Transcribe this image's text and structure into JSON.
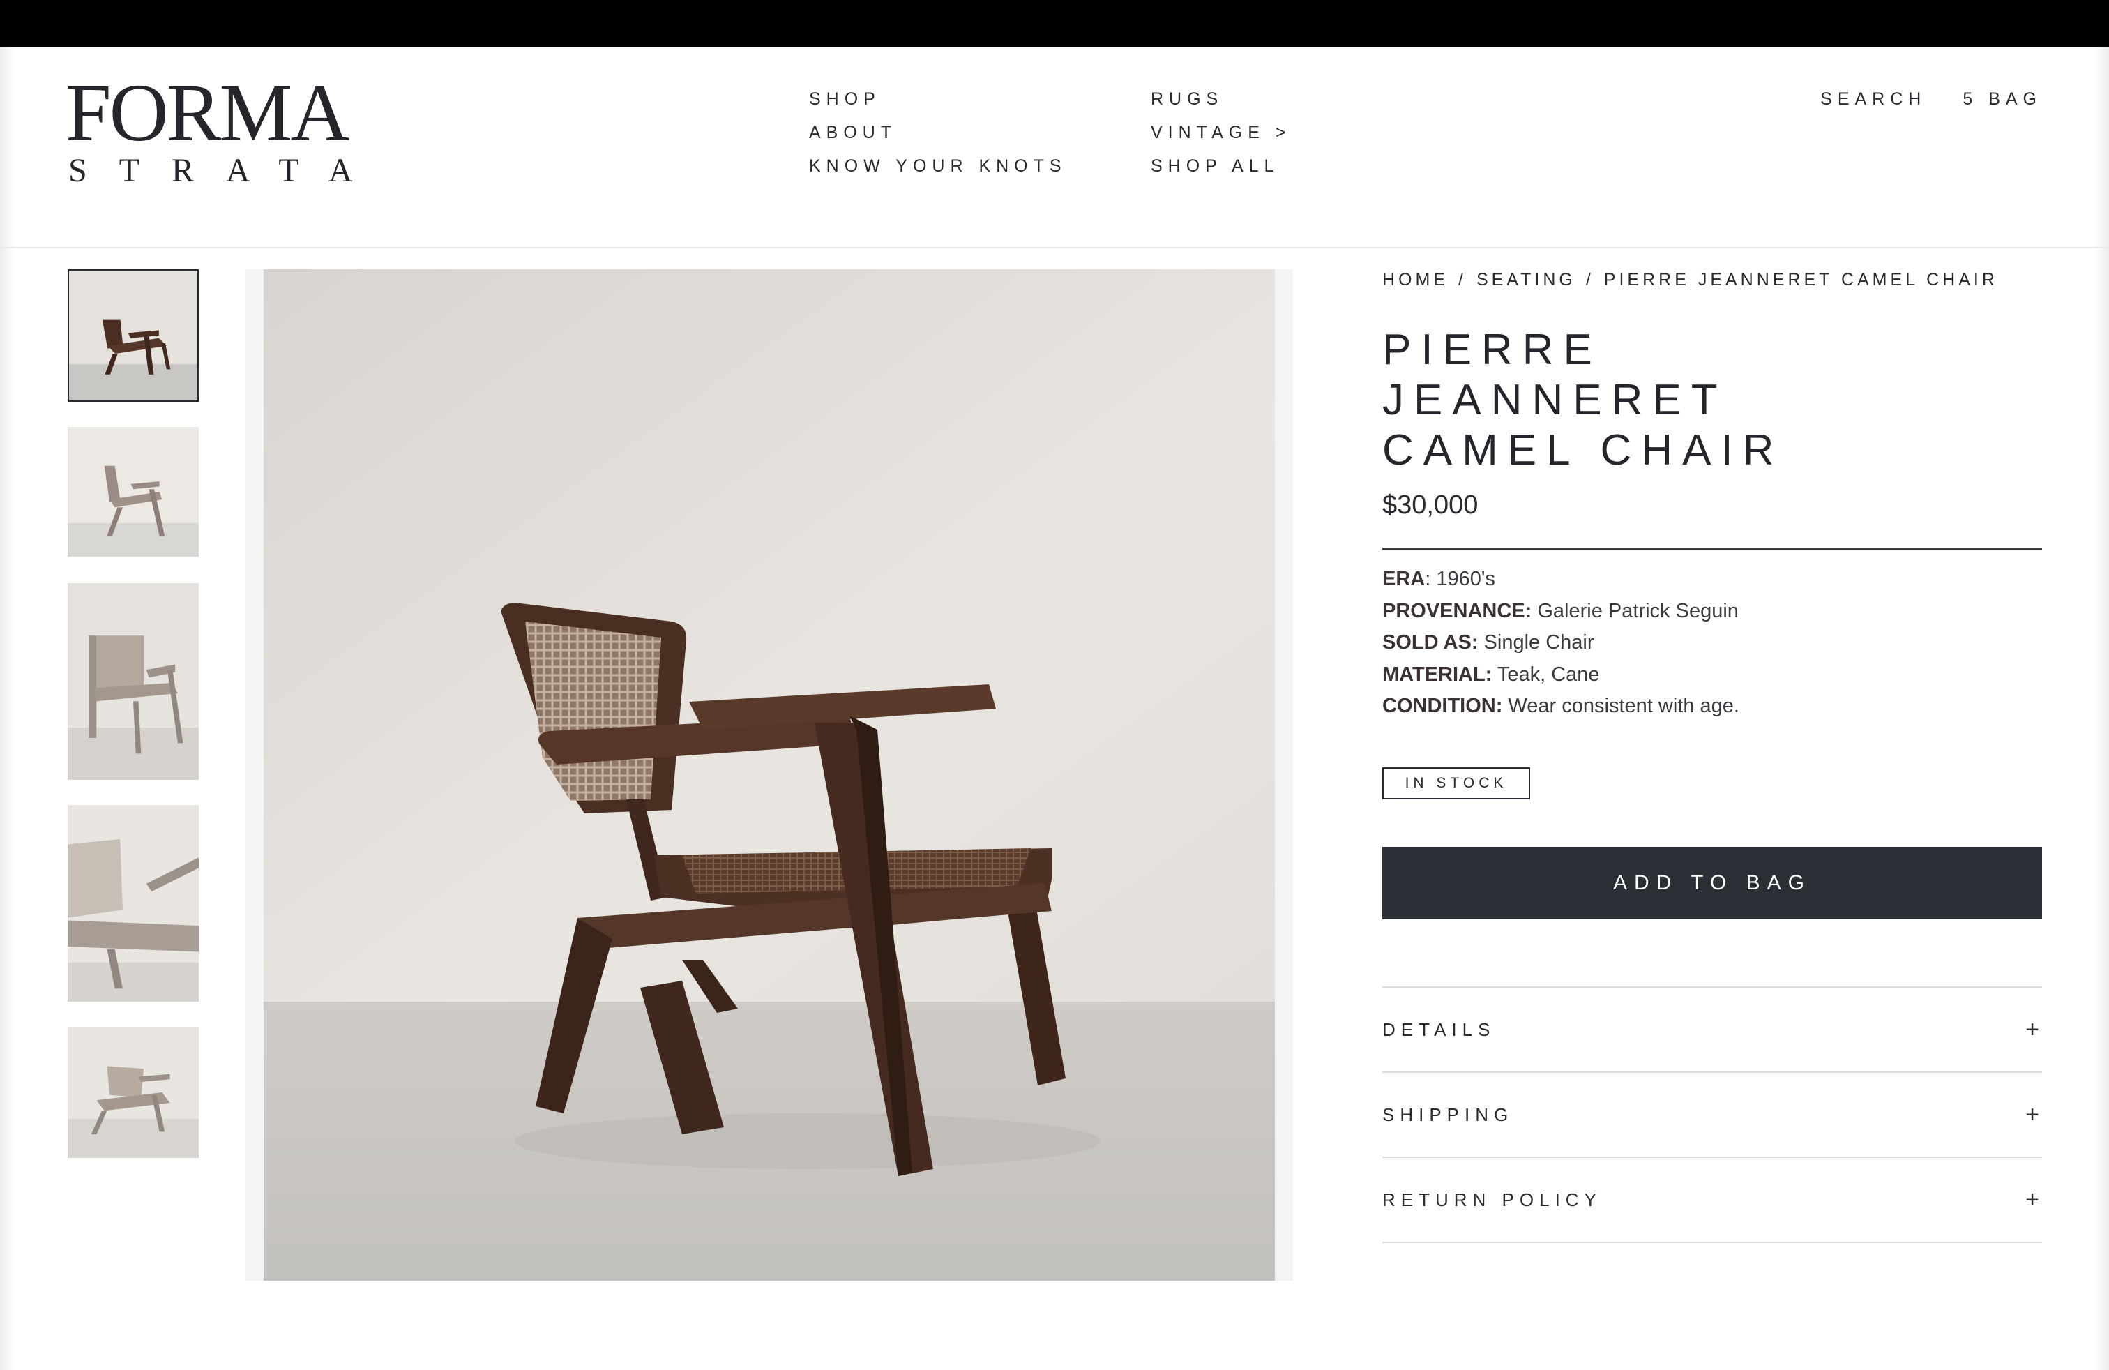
{
  "brand": {
    "top": "FORMA",
    "bottom": "STRATA"
  },
  "nav": {
    "col1": [
      {
        "label": "SHOP"
      },
      {
        "label": "ABOUT"
      },
      {
        "label": "KNOW YOUR KNOTS"
      }
    ],
    "col2": [
      {
        "label": "RUGS"
      },
      {
        "label": "VINTAGE >"
      },
      {
        "label": "SHOP ALL"
      }
    ],
    "search_label": "SEARCH",
    "bag_label": "5 BAG"
  },
  "breadcrumb": {
    "home": "HOME",
    "sep": "/",
    "category": "SEATING",
    "current": "PIERRE JEANNERET CAMEL CHAIR"
  },
  "product": {
    "title_lines": [
      "PIERRE",
      "JEANNERET",
      "CAMEL CHAIR"
    ],
    "price": "$30,000",
    "specs": [
      {
        "label": "ERA",
        "sep": ":",
        "value": " 1960's"
      },
      {
        "label": "PROVENANCE:",
        "sep": "",
        "value": " Galerie Patrick Seguin"
      },
      {
        "label": "SOLD AS:",
        "sep": "",
        "value": " Single Chair"
      },
      {
        "label": "MATERIAL:",
        "sep": "",
        "value": " Teak, Cane"
      },
      {
        "label": "CONDITION:",
        "sep": "",
        "value": " Wear consistent with age."
      }
    ],
    "stock_status": "IN STOCK",
    "add_to_bag": "ADD TO BAG"
  },
  "accordion": [
    {
      "label": "DETAILS",
      "icon": "plus-icon",
      "symbol": "+"
    },
    {
      "label": "SHIPPING",
      "icon": "plus-icon",
      "symbol": "+"
    },
    {
      "label": "RETURN POLICY",
      "icon": "plus-icon",
      "symbol": "+"
    }
  ],
  "colors": {
    "accent_dark": "#2c2f35",
    "text": "#2a2b30",
    "wood": "#4a2e22",
    "cane": "#a88e7a",
    "wall": "#e6e2dd",
    "floor": "#c8c6c3"
  }
}
